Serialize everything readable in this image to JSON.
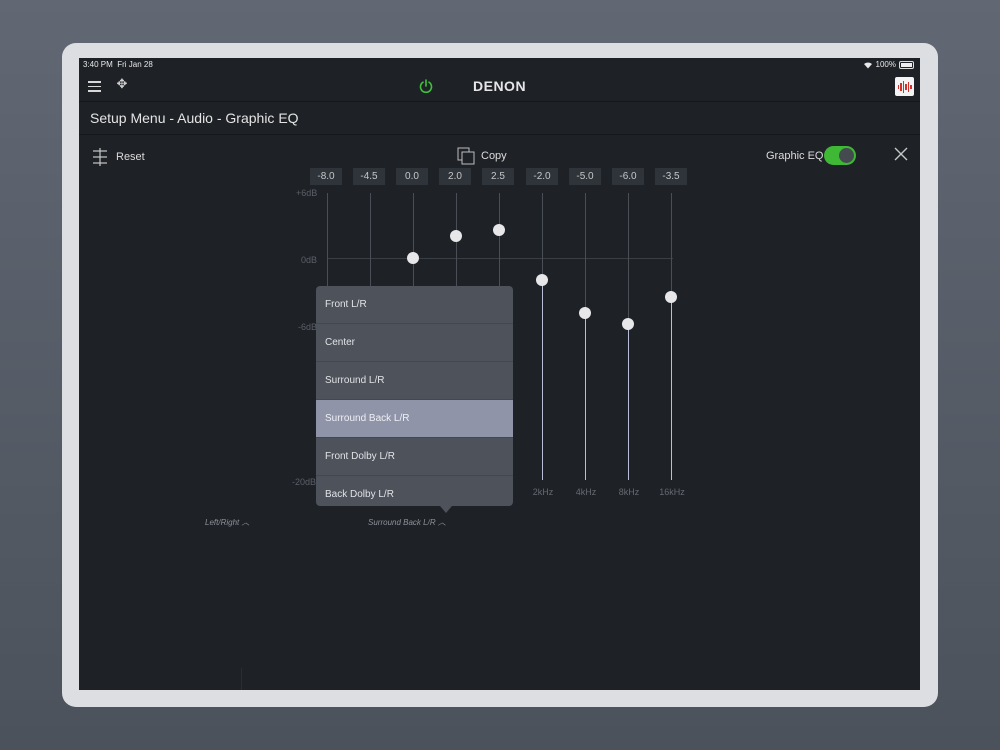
{
  "status": {
    "time": "3:40 PM",
    "date": "Fri Jan 28",
    "battery": "100%"
  },
  "app": {
    "brand": "DENON"
  },
  "page": {
    "title": "Setup Menu - Audio - Graphic EQ"
  },
  "toolbar": {
    "reset_label": "Reset",
    "copy_label": "Copy",
    "graphic_eq_label": "Graphic EQ",
    "graphic_eq_on": true
  },
  "colors": {
    "accent_green": "#3fb836",
    "background": "#1e2126",
    "selected_item": "#9094a9"
  },
  "eq": {
    "values": [
      "-8.0",
      "-4.5",
      "0.0",
      "2.0",
      "2.5",
      "-2.0",
      "-5.0",
      "-6.0",
      "-3.5"
    ],
    "db_labels": [
      "+6dB",
      "0dB",
      "-6dB",
      "-20dB"
    ],
    "freq_labels": [
      "2kHz",
      "4kHz",
      "8kHz",
      "16kHz"
    ]
  },
  "channels": {
    "left_label": "Left/Right",
    "current_label": "Surround Back L/R"
  },
  "dropdown": {
    "items": [
      "Front L/R",
      "Center",
      "Surround L/R",
      "Surround Back L/R",
      "Front Dolby L/R",
      "Back Dolby L/R"
    ],
    "selected": "Surround Back L/R"
  }
}
